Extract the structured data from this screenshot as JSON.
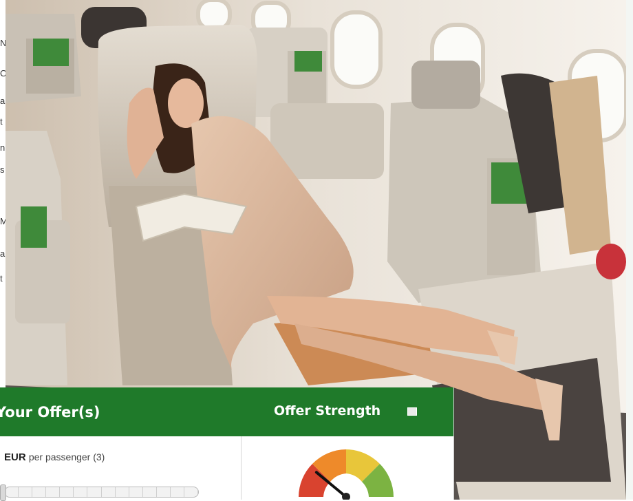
{
  "offer_panel": {
    "title": "Your Offer(s)",
    "strength_title": "Offer Strength",
    "currency": "EUR",
    "per_passenger_label": "per passenger (3)"
  },
  "offer_strength": {
    "needle_fraction": 0.22
  },
  "background_text_fragments": [
    "N",
    "O",
    "a",
    "t",
    "n",
    "s",
    "M",
    "a",
    "t"
  ],
  "colors": {
    "header_green": "#1f7a2a",
    "gauge_red": "#d9432f",
    "gauge_orange": "#ee8a2a",
    "gauge_yellow": "#e8c63a",
    "gauge_green": "#7cb342"
  }
}
